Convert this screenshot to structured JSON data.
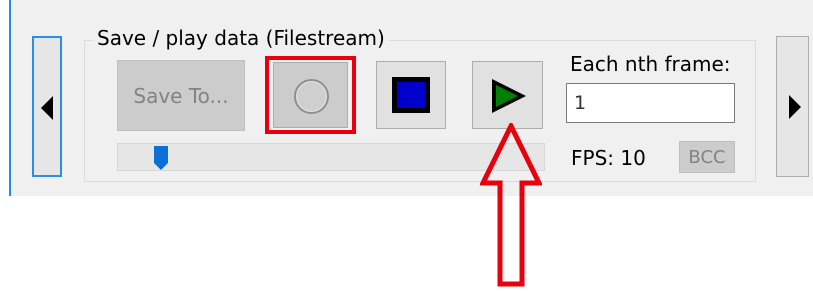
{
  "group": {
    "title": "Save / play data (Filestream)"
  },
  "buttons": {
    "save_to": "Save To...",
    "bcc": "BCC"
  },
  "icons": {
    "record": "record-circle-icon",
    "stop": "stop-square-icon",
    "play": "play-triangle-icon",
    "nav_left": "triangle-left-icon",
    "nav_right": "triangle-right-icon"
  },
  "frame": {
    "label": "Each nth frame:",
    "value": "1"
  },
  "fps": {
    "label": "FPS: 10"
  },
  "slider": {
    "position_fraction": 0.1
  },
  "colors": {
    "record_highlight": "#e8000e",
    "annotation_arrow": "#e8000e",
    "stop_fill": "#0000cc",
    "play_fill": "#008000",
    "slider_thumb": "#0a6fd6",
    "focus_border": "#2a8ee8"
  }
}
